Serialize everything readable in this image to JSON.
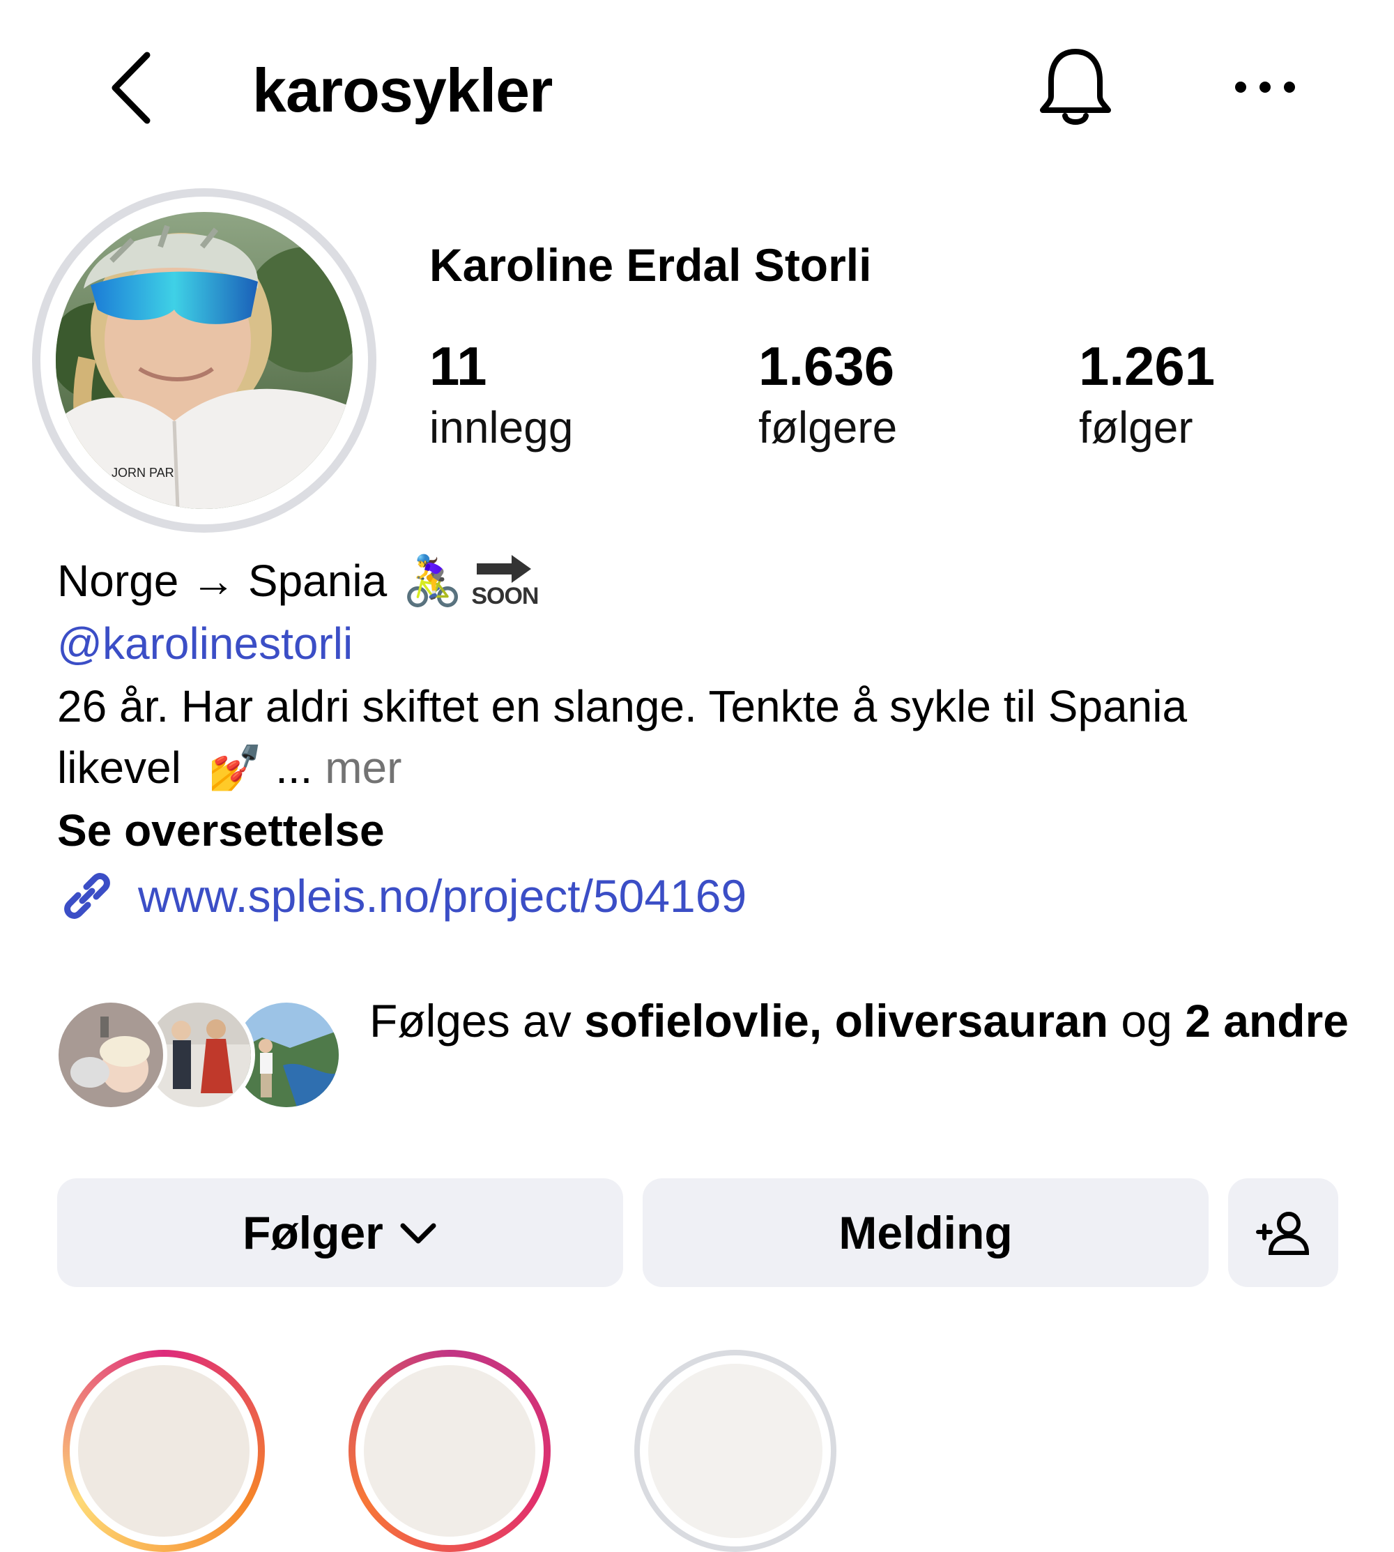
{
  "header": {
    "username": "karosykler",
    "back_icon": "chevron-left-icon",
    "bell_icon": "bell-icon",
    "more_icon": "more-horizontal-icon"
  },
  "profile": {
    "full_name": "Karoline Erdal Storli",
    "stats": [
      {
        "value": "11",
        "label": "innlegg"
      },
      {
        "value": "1.636",
        "label": "følgere"
      },
      {
        "value": "1.261",
        "label": "følger"
      }
    ]
  },
  "bio": {
    "line1_text": "Norge → Spania",
    "line1_emoji": "🚴‍♀️",
    "line1_soon_label": "SOON",
    "mention": "@karolinestorli",
    "line2_text": "26 år. Har aldri skiftet en slange. Tenkte å sykle til Spania",
    "line3_text": "likevel",
    "line3_emoji": "💅",
    "ellipsis": " ... ",
    "more_label": "mer",
    "translate_label": "Se oversettelse",
    "link": "www.spleis.no/project/504169"
  },
  "followed_by": {
    "prefix": "Følges av ",
    "user1": "sofielovlie",
    "separator": ", ",
    "user2": "oliversauran",
    "connector": " og ",
    "others": "2 andre"
  },
  "actions": {
    "follow_label": "Følger",
    "message_label": "Melding",
    "add_user_icon": "add-person-icon"
  },
  "colors": {
    "link_blue": "#3b4ec6",
    "button_bg": "#eff0f5",
    "muted": "#737373",
    "story_ring_start": "#f58529",
    "story_ring_end": "#dd2a7b"
  }
}
